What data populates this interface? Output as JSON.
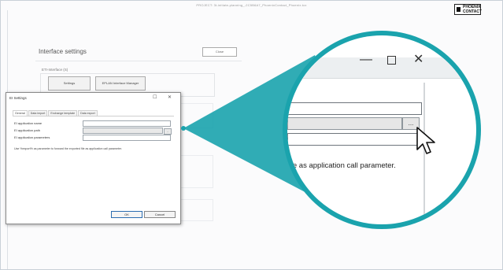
{
  "window": {
    "title": "PROJECT: 3t-initiate-planning_-2C5B6A7_PhoenixContact_Phoenix.tcx",
    "logo": "PHOENIX CONTACT"
  },
  "interface_settings": {
    "title": "Interface settings",
    "close_label": "Close",
    "group_label": "ETI-Interface (S)",
    "buttons": [
      "Settings",
      "EPLAN Interface Manager"
    ]
  },
  "dialog": {
    "title": "EI Settings",
    "controls": {
      "minimize": "—",
      "maximize": "☐",
      "close": "✕"
    },
    "tabs": [
      "General",
      "Data import",
      "Exchange template",
      "Data export"
    ],
    "active_tab": "General",
    "fields": [
      {
        "label": "EI application name"
      },
      {
        "label": "EI application path"
      },
      {
        "label": "EI application parameters"
      }
    ],
    "browse_label": "...",
    "hint": "Use %export% as parameter to forward the exported file as application call parameter.",
    "ok_label": "OK",
    "cancel_label": "Cancel"
  },
  "zoom": {
    "browse_label": "...",
    "hint_fragment": "file as application call parameter.",
    "accent_color": "#1aa3ad"
  }
}
